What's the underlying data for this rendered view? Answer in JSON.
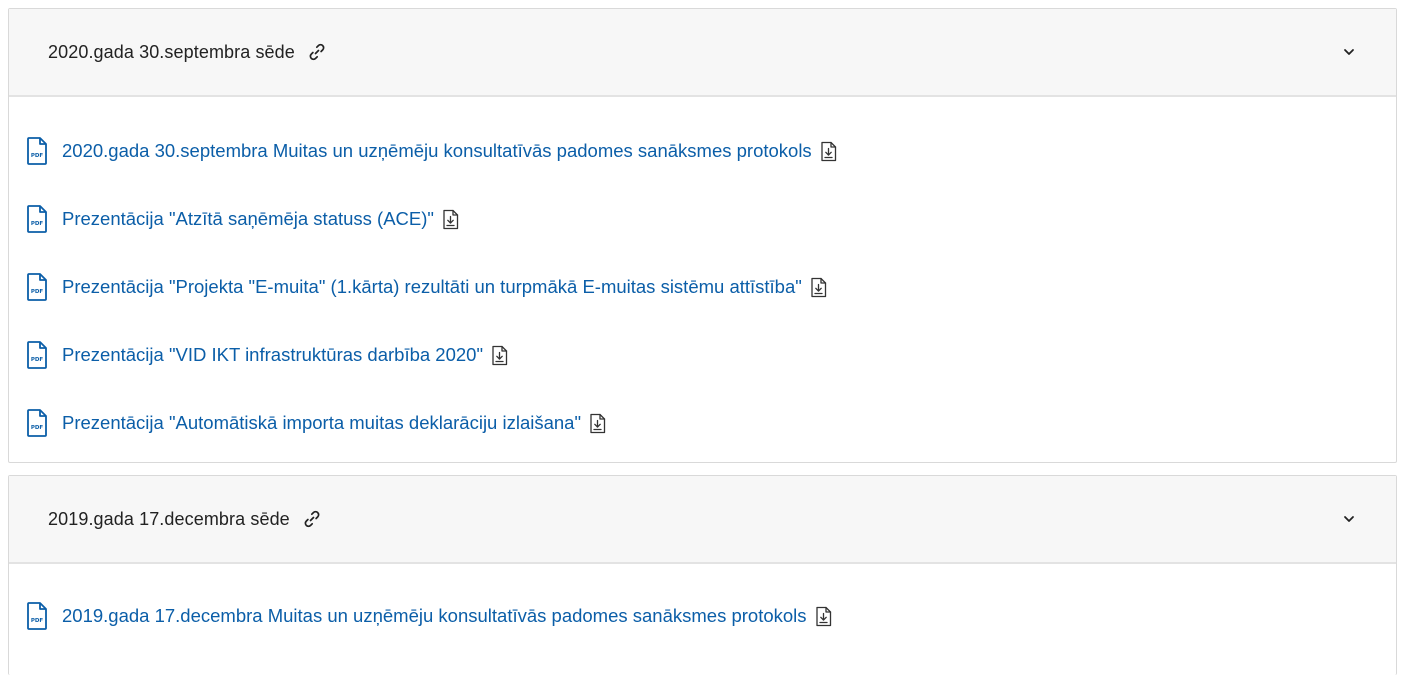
{
  "sections": [
    {
      "title": "2020.gada 30.septembra sēde",
      "files": [
        {
          "label": "2020.gada 30.septembra Muitas un uzņēmēju konsultatīvās padomes sanāksmes protokols"
        },
        {
          "label": "Prezentācija \"Atzītā saņēmēja statuss (ACE)\""
        },
        {
          "label": "Prezentācija \"Projekta \"E-muita\" (1.kārta) rezultāti un turpmākā E-muitas sistēmu attīstība\""
        },
        {
          "label": "Prezentācija \"VID IKT infrastruktūras darbība 2020\""
        },
        {
          "label": "Prezentācija \"Automātiskā importa muitas deklarāciju izlaišana\""
        }
      ]
    },
    {
      "title": "2019.gada 17.decembra sēde",
      "files": [
        {
          "label": "2019.gada 17.decembra Muitas un uzņēmēju konsultatīvās padomes sanāksmes protokols"
        }
      ]
    }
  ],
  "icons": {
    "link": "link-icon",
    "chevron": "chevron-down-icon",
    "file": "pdf-file-icon",
    "download": "download-icon",
    "pdf_badge_text": "PDF"
  },
  "colors": {
    "link": "#0b5ea8",
    "header_bg": "#f7f7f7",
    "border": "#d9d9d9"
  }
}
